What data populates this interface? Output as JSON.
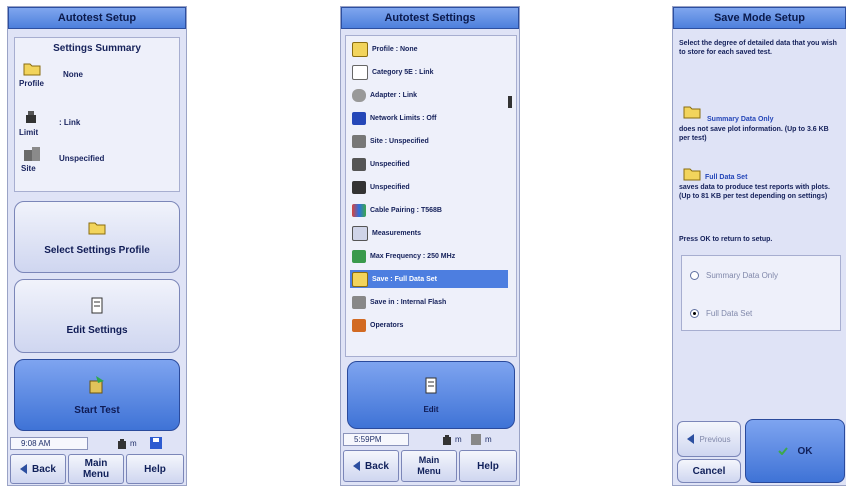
{
  "panel1": {
    "title": "Autotest Setup",
    "summary_heading": "Settings Summary",
    "items": [
      {
        "caption": "Profile",
        "value": "None",
        "icon": "folder-icon"
      },
      {
        "caption": "Limit",
        "value": ": Link",
        "icon": "limit-icon"
      },
      {
        "caption": "Site",
        "value": "Unspecified",
        "icon": "site-icon"
      }
    ],
    "select_profile_label": "Select Settings Profile",
    "edit_settings_label": "Edit Settings",
    "start_test_label": "Start Test",
    "status_time": "9:08 AM",
    "status_unit": "m",
    "nav": {
      "back": "Back",
      "main_menu": "Main Menu",
      "help": "Help"
    }
  },
  "panel2": {
    "title": "Autotest Settings",
    "rows": [
      "Profile : None",
      "Category 5E : Link",
      "Adapter : Link",
      "Network Limits : Off",
      "Site : Unspecified",
      "Unspecified",
      "Unspecified",
      "Cable Pairing : T568B",
      "Measurements",
      "Max Frequency : 250 MHz",
      "Save : Full Data Set",
      "Save in : Internal Flash",
      "Operators"
    ],
    "selected_index": 10,
    "edit_label": "Edit",
    "status_time": "5:59PM",
    "status_unit_1": "m",
    "status_unit_2": "m",
    "nav": {
      "back": "Back",
      "main_menu": "Main Menu",
      "help": "Help"
    }
  },
  "panel3": {
    "title": "Save Mode Setup",
    "intro": "Select the degree of detailed data that you wish to store for each saved test.",
    "summary_option_desc_title": "Summary Data Only",
    "summary_option_desc": "does not save plot information. (Up to 3.6 KB per test)",
    "full_option_desc_title": "Full Data Set",
    "full_option_desc": "saves data to produce test reports with plots. (Up to 81 KB per test depending on settings)",
    "press_ok": "Press OK to return to setup.",
    "options": [
      "Summary Data Only",
      "Full Data Set"
    ],
    "selected_option": "Full Data Set",
    "previous_label": "Previous",
    "ok_label": "OK",
    "cancel_label": "Cancel"
  }
}
